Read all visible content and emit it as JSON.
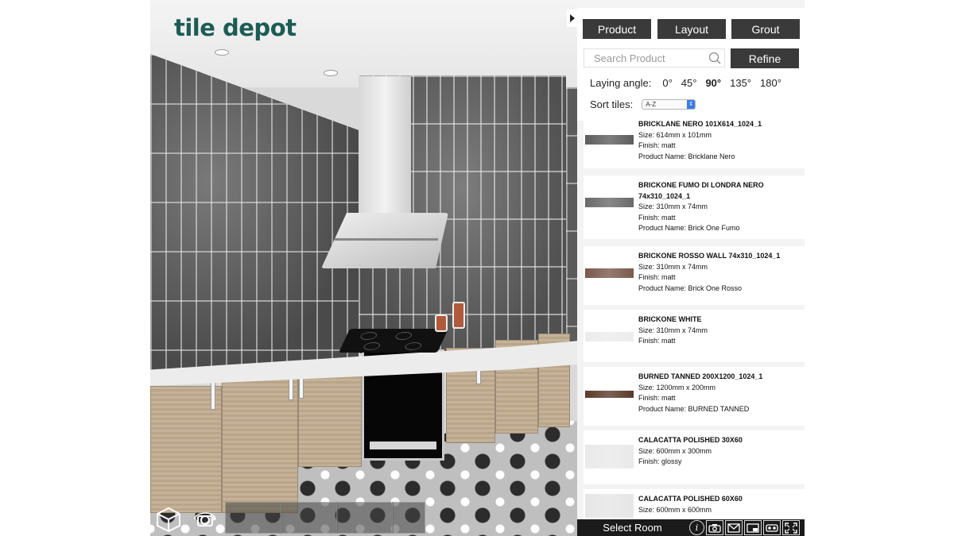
{
  "brand": {
    "logo_text": "tile depot"
  },
  "panel": {
    "tabs": [
      {
        "label": "Product"
      },
      {
        "label": "Layout"
      },
      {
        "label": "Grout"
      }
    ],
    "search": {
      "placeholder": "Search Product"
    },
    "refine_label": "Refine",
    "laying_angle": {
      "label": "Laying angle:",
      "options": [
        "0°",
        "45°",
        "90°",
        "135°",
        "180°"
      ],
      "selected": "90°"
    },
    "sort": {
      "label": "Sort tiles:",
      "value": "A-Z"
    }
  },
  "products": [
    {
      "title": "BRICKLANE NERO 101X614_1024_1",
      "size": "Size: 614mm x 101mm",
      "finish": "Finish: matt",
      "product_name": "Product Name: Bricklane Nero",
      "swatch": "#5d5d5d"
    },
    {
      "title": "BRICKONE FUMO DI LONDRA NERO 74x310_1024_1",
      "size": "Size: 310mm x 74mm",
      "finish": "Finish: matt",
      "product_name": "Product Name: Brick One Fumo",
      "swatch": "#6a6a6a"
    },
    {
      "title": "BRICKONE ROSSO WALL 74x310_1024_1",
      "size": "Size: 310mm x 74mm",
      "finish": "Finish: matt",
      "product_name": "Product Name: Brick One Rosso",
      "swatch": "#7a5a4c"
    },
    {
      "title": "BRICKONE WHITE",
      "size": "Size: 310mm x 74mm",
      "finish": "Finish: matt",
      "product_name": "",
      "swatch": "#ececec"
    },
    {
      "title": "BURNED TANNED 200X1200_1024_1",
      "size": "Size: 1200mm x 200mm",
      "finish": "Finish: matt",
      "product_name": "Product Name: BURNED TANNED",
      "swatch": "#5a3a2a"
    },
    {
      "title": "CALACATTA POLISHED 30X60",
      "size": "Size: 600mm x 300mm",
      "finish": "Finish: glossy",
      "product_name": "",
      "swatch": "#e9e9e9"
    },
    {
      "title": "CALACATTA POLISHED 60X60",
      "size": "Size: 600mm x 600mm",
      "finish": "",
      "product_name": "",
      "swatch": "#e6e6e6"
    }
  ],
  "bottom_bar": {
    "select_room_label": "Select Room"
  },
  "icons": {
    "info": "info-icon",
    "camera": "camera-icon",
    "email": "email-icon",
    "window": "window-icon",
    "vr": "vr-headset-icon",
    "fullscreen": "fullscreen-icon"
  }
}
